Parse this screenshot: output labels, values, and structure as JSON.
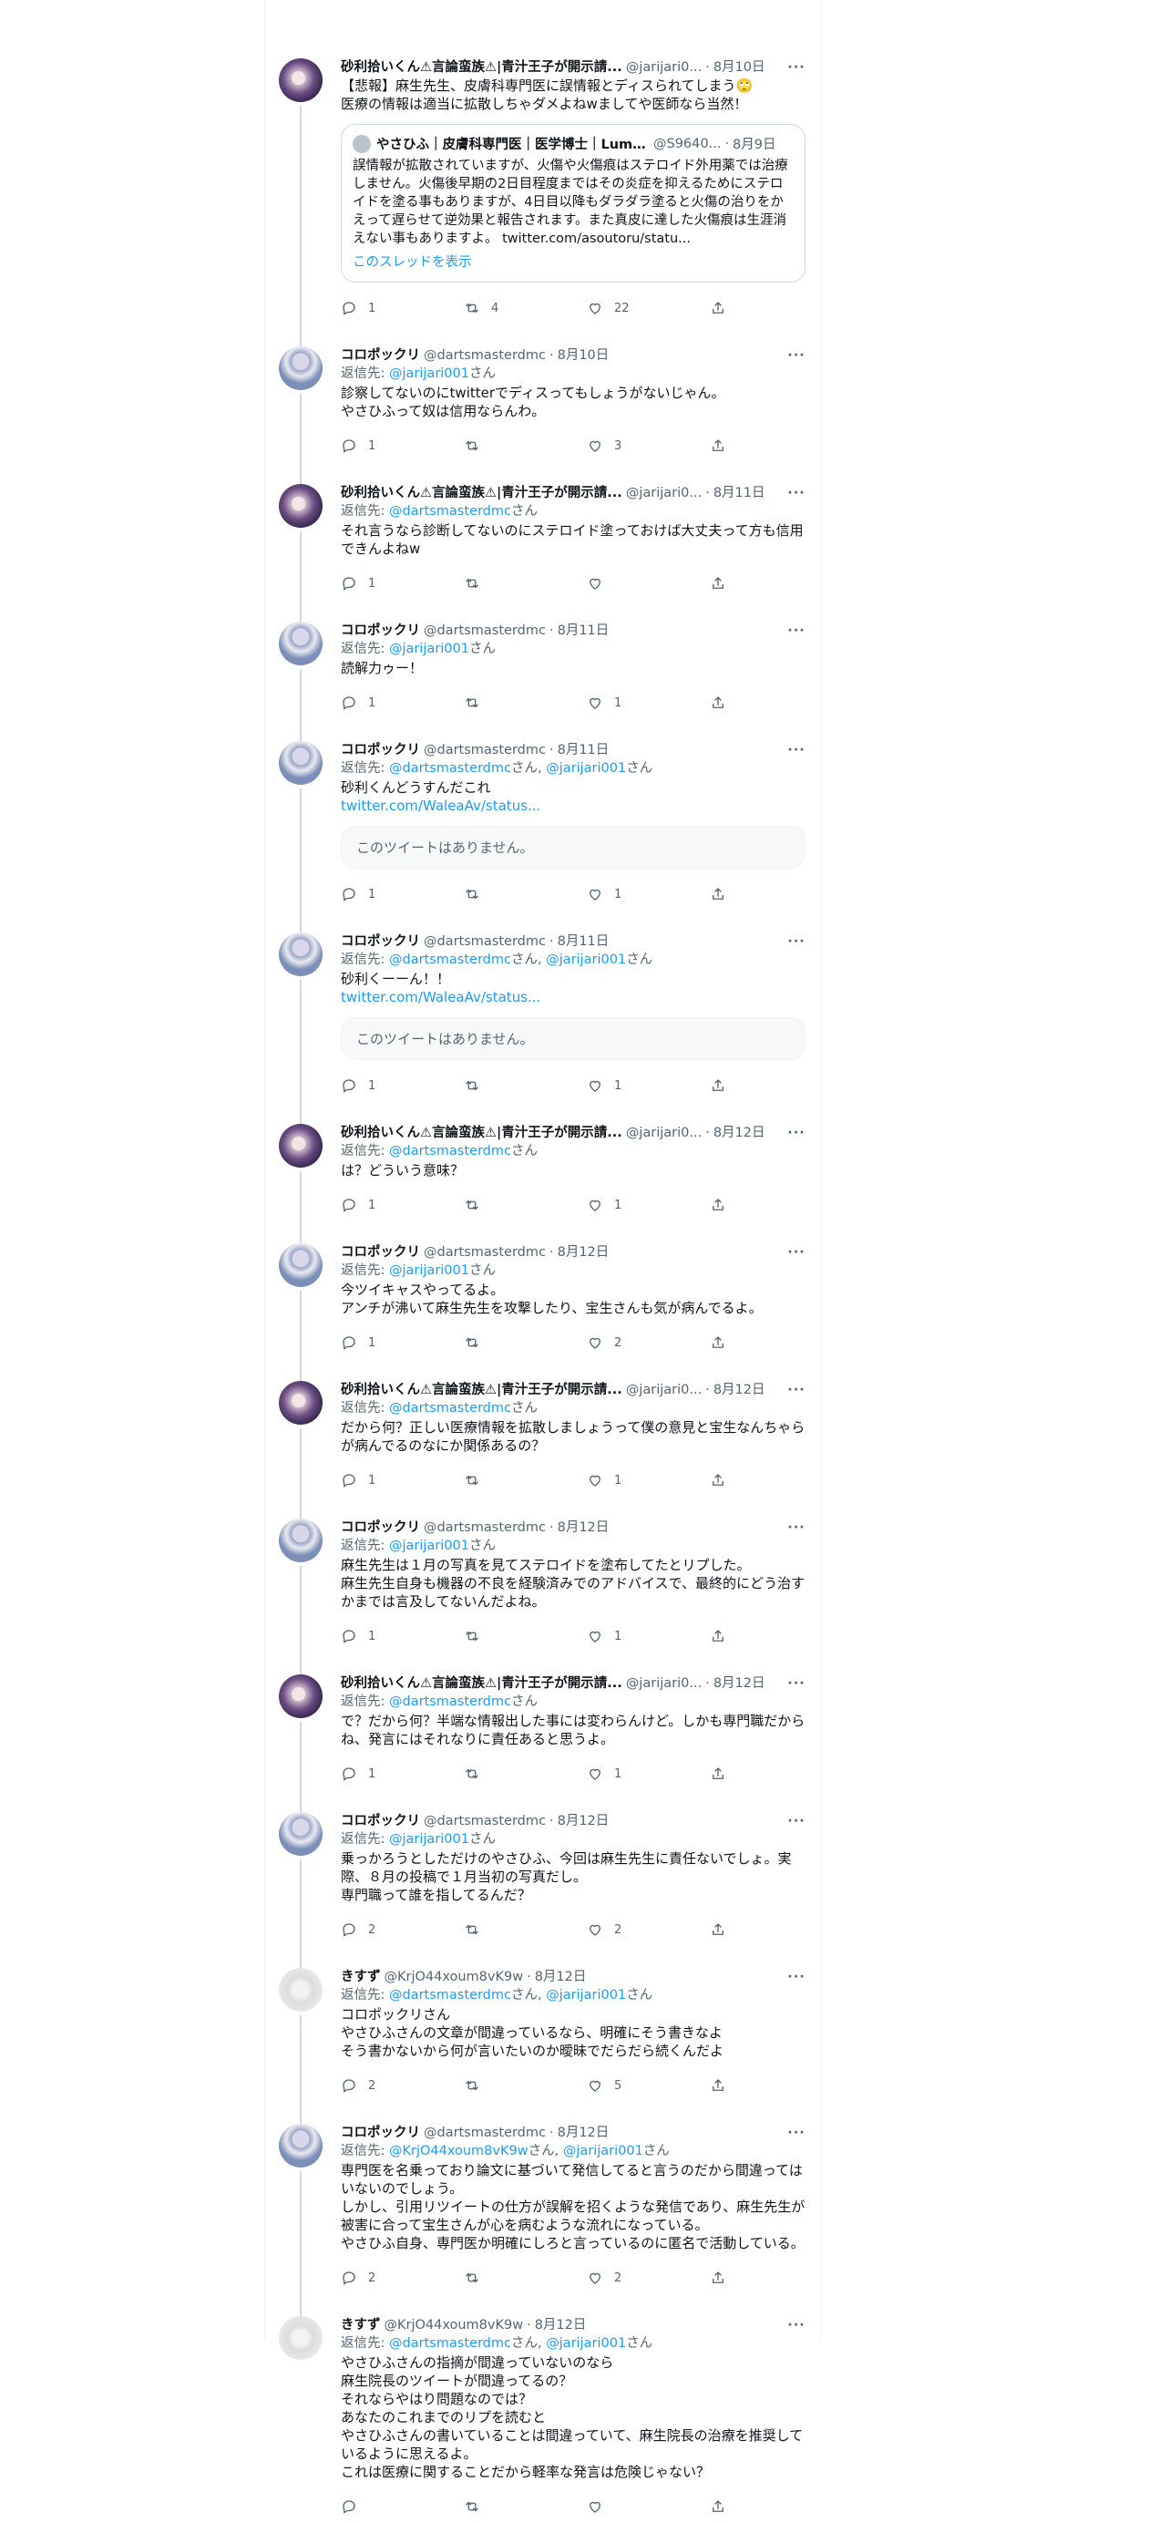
{
  "tweets": [
    {
      "avatar": "sari",
      "name": "砂利拾いくん⚠言論蛮族⚠|青汁王子が開示請...",
      "handle": "@jarijari0...",
      "date": "8月10日",
      "reply_to": [],
      "body": "【悲報】麻生先生、皮膚科専門医に誤情報とディスられてしまう🙄\n医療の情報は適当に拡散しちゃダメよねwましてや医師なら当然！",
      "quote": {
        "name": "やさひふ｜皮膚科専門医｜医学博士｜Lumedi...",
        "handle": "@S9640...",
        "date": "8月9日",
        "body": "誤情報が拡散されていますが、火傷や火傷痕はステロイド外用薬では治療しません。火傷後早期の2日目程度まではその炎症を抑えるためにステロイドを塗る事もありますが、4日目以降もダラダラ塗ると火傷の治りをかえって遅らせて逆効果と報告されます。また真皮に達した火傷痕は生涯消えない事もありますよ。 twitter.com/asoutoru/statu...",
        "thread": "このスレッドを表示"
      },
      "replies": "1",
      "retweets": "4",
      "likes": "22"
    },
    {
      "avatar": "koro",
      "name": "コロポックリ",
      "handle": "@dartsmasterdmc",
      "date": "8月10日",
      "reply_to": [
        "@jarijari001"
      ],
      "body": "診察してないのにtwitterでディスってもしょうがないじゃん。\nやさひふって奴は信用ならんわ。",
      "replies": "1",
      "retweets": "",
      "likes": "3"
    },
    {
      "avatar": "sari",
      "name": "砂利拾いくん⚠言論蛮族⚠|青汁王子が開示請...",
      "handle": "@jarijari0...",
      "date": "8月11日",
      "reply_to": [
        "@dartsmasterdmc"
      ],
      "body": "それ言うなら診断してないのにステロイド塗っておけば大丈夫って方も信用できんよねw",
      "replies": "1",
      "retweets": "",
      "likes": ""
    },
    {
      "avatar": "koro",
      "name": "コロポックリ",
      "handle": "@dartsmasterdmc",
      "date": "8月11日",
      "reply_to": [
        "@jarijari001"
      ],
      "body": "読解力ゥー！",
      "replies": "1",
      "retweets": "",
      "likes": "1"
    },
    {
      "avatar": "koro",
      "name": "コロポックリ",
      "handle": "@dartsmasterdmc",
      "date": "8月11日",
      "reply_to": [
        "@dartsmasterdmc",
        "@jarijari001"
      ],
      "body": "砂利くんどうすんだこれ",
      "link": "twitter.com/WaleaAv/status...",
      "unavailable": "このツイートはありません。",
      "replies": "1",
      "retweets": "",
      "likes": "1"
    },
    {
      "avatar": "koro",
      "name": "コロポックリ",
      "handle": "@dartsmasterdmc",
      "date": "8月11日",
      "reply_to": [
        "@dartsmasterdmc",
        "@jarijari001"
      ],
      "body": "砂利くーーん！！",
      "link": "twitter.com/WaleaAv/status...",
      "unavailable": "このツイートはありません。",
      "replies": "1",
      "retweets": "",
      "likes": "1"
    },
    {
      "avatar": "sari",
      "name": "砂利拾いくん⚠言論蛮族⚠|青汁王子が開示請...",
      "handle": "@jarijari0...",
      "date": "8月12日",
      "reply_to": [
        "@dartsmasterdmc"
      ],
      "body": "は？どういう意味？",
      "replies": "1",
      "retweets": "",
      "likes": "1"
    },
    {
      "avatar": "koro",
      "name": "コロポックリ",
      "handle": "@dartsmasterdmc",
      "date": "8月12日",
      "reply_to": [
        "@jarijari001"
      ],
      "body": "今ツイキャスやってるよ。\nアンチが沸いて麻生先生を攻撃したり、宝生さんも気が病んでるよ。",
      "replies": "1",
      "retweets": "",
      "likes": "2"
    },
    {
      "avatar": "sari",
      "name": "砂利拾いくん⚠言論蛮族⚠|青汁王子が開示請...",
      "handle": "@jarijari0...",
      "date": "8月12日",
      "reply_to": [
        "@dartsmasterdmc"
      ],
      "body": "だから何？正しい医療情報を拡散しましょうって僕の意見と宝生なんちゃらが病んでるのなにか関係あるの？",
      "replies": "1",
      "retweets": "",
      "likes": "1"
    },
    {
      "avatar": "koro",
      "name": "コロポックリ",
      "handle": "@dartsmasterdmc",
      "date": "8月12日",
      "reply_to": [
        "@jarijari001"
      ],
      "body": "麻生先生は１月の写真を見てステロイドを塗布してたとリプした。\n麻生先生自身も機器の不良を経験済みでのアドバイスで、最終的にどう治すかまでは言及してないんだよね。",
      "replies": "1",
      "retweets": "",
      "likes": "1"
    },
    {
      "avatar": "sari",
      "name": "砂利拾いくん⚠言論蛮族⚠|青汁王子が開示請...",
      "handle": "@jarijari0...",
      "date": "8月12日",
      "reply_to": [
        "@dartsmasterdmc"
      ],
      "body": "で？だから何？半端な情報出した事には変わらんけど。しかも専門職だからね、発言にはそれなりに責任あると思うよ。",
      "replies": "1",
      "retweets": "",
      "likes": "1"
    },
    {
      "avatar": "koro",
      "name": "コロポックリ",
      "handle": "@dartsmasterdmc",
      "date": "8月12日",
      "reply_to": [
        "@jarijari001"
      ],
      "body": "乗っかろうとしただけのやさひふ、今回は麻生先生に責任ないでしょ。実際、８月の投稿で１月当初の写真だし。\n専門職って誰を指してるんだ？",
      "replies": "2",
      "retweets": "",
      "likes": "2"
    },
    {
      "avatar": "kisu",
      "name": "きすず",
      "handle": "@KrjO44xoum8vK9w",
      "date": "8月12日",
      "reply_to": [
        "@dartsmasterdmc",
        "@jarijari001"
      ],
      "body": "コロポックリさん\nやさひふさんの文章が間違っているなら、明確にそう書きなよ\nそう書かないから何が言いたいのか曖昧でだらだら続くんだよ",
      "replies": "2",
      "retweets": "",
      "likes": "5"
    },
    {
      "avatar": "koro",
      "name": "コロポックリ",
      "handle": "@dartsmasterdmc",
      "date": "8月12日",
      "reply_to": [
        "@KrjO44xoum8vK9w",
        "@jarijari001"
      ],
      "body": "専門医を名乗っており論文に基づいて発信してると言うのだから間違ってはいないのでしょう。\nしかし、引用リツイートの仕方が誤解を招くような発信であり、麻生先生が被害に合って宝生さんが心を病むような流れになっている。\nやさひふ自身、専門医か明確にしろと言っているのに匿名で活動している。",
      "replies": "2",
      "retweets": "",
      "likes": "2"
    },
    {
      "avatar": "kisu",
      "name": "きすず",
      "handle": "@KrjO44xoum8vK9w",
      "date": "8月12日",
      "reply_to": [
        "@dartsmasterdmc",
        "@jarijari001"
      ],
      "body": "やさひふさんの指摘が間違っていないのなら\n麻生院長のツイートが間違ってるの？\nそれならやはり問題なのでは？\nあなたのこれまでのリプを読むと\nやさひふさんの書いていることは間違っていて、麻生院長の治療を推奨しているように思えるよ。\nこれは医療に関することだから軽率な発言は危険じゃない？",
      "replies": "",
      "retweets": "",
      "likes": ""
    }
  ],
  "labels": {
    "reply_prefix": "返信先: ",
    "san": "さん",
    "sep": "·",
    "more": "···"
  }
}
